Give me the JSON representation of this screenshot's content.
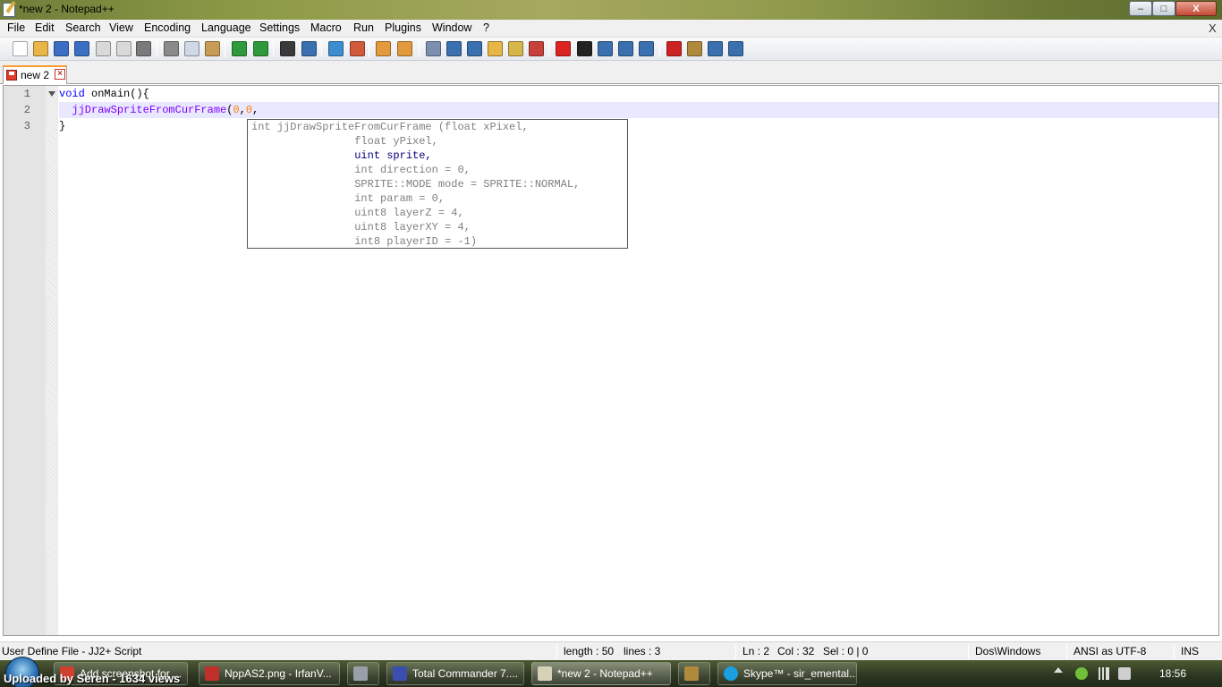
{
  "window": {
    "title": "*new  2 - Notepad++",
    "min_glyph": "–",
    "max_glyph": "□",
    "close_glyph": "X"
  },
  "menu": {
    "items": [
      "File",
      "Edit",
      "Search",
      "View",
      "Encoding",
      "Language",
      "Settings",
      "Macro",
      "Run",
      "Plugins",
      "Window",
      "?"
    ],
    "close_doc": "X"
  },
  "toolbar": {
    "buttons": [
      {
        "name": "new-file-icon",
        "color": "#ffffff"
      },
      {
        "name": "open-file-icon",
        "color": "#e7b646"
      },
      {
        "name": "save-icon",
        "color": "#3b6fc4"
      },
      {
        "name": "save-all-icon",
        "color": "#3b6fc4"
      },
      {
        "name": "close-icon",
        "color": "#d9d9d9"
      },
      {
        "name": "close-all-icon",
        "color": "#d9d9d9"
      },
      {
        "name": "print-icon",
        "color": "#7a7a7a"
      },
      {
        "name": "cut-icon",
        "color": "#8a8a8a"
      },
      {
        "name": "copy-icon",
        "color": "#cfd8e6"
      },
      {
        "name": "paste-icon",
        "color": "#c89b56"
      },
      {
        "name": "undo-icon",
        "color": "#2f9a3b"
      },
      {
        "name": "redo-icon",
        "color": "#2f9a3b"
      },
      {
        "name": "find-icon",
        "color": "#3a3a3a"
      },
      {
        "name": "replace-icon",
        "color": "#3a6fb0"
      },
      {
        "name": "zoom-in-icon",
        "color": "#3b8fd0"
      },
      {
        "name": "zoom-out-icon",
        "color": "#d05a3b"
      },
      {
        "name": "sync-vertical-icon",
        "color": "#e39a3c"
      },
      {
        "name": "sync-horizontal-icon",
        "color": "#e39a3c"
      },
      {
        "name": "word-wrap-icon",
        "color": "#7d8fb0"
      },
      {
        "name": "show-all-chars-icon",
        "color": "#3a6fb0"
      },
      {
        "name": "indent-guide-icon",
        "color": "#3a6fb0"
      },
      {
        "name": "folder-as-workspace-icon",
        "color": "#e7b646"
      },
      {
        "name": "doc-map-icon",
        "color": "#d6b54a"
      },
      {
        "name": "function-list-icon",
        "color": "#c7423b"
      },
      {
        "name": "record-macro-icon",
        "color": "#d22"
      },
      {
        "name": "stop-record-icon",
        "color": "#222"
      },
      {
        "name": "play-macro-icon",
        "color": "#3a6fb0"
      },
      {
        "name": "run-macro-multiple-icon",
        "color": "#3a6fb0"
      },
      {
        "name": "save-macro-icon",
        "color": "#3a6fb0"
      },
      {
        "name": "spell-check-icon",
        "color": "#c22"
      },
      {
        "name": "plugin-a-icon",
        "color": "#b08a3c"
      },
      {
        "name": "plugin-b-icon",
        "color": "#3a6fb0"
      },
      {
        "name": "auto-spell-icon",
        "color": "#3a6fb0"
      }
    ]
  },
  "tabs": [
    {
      "label": "new  2"
    }
  ],
  "editor": {
    "line_numbers": [
      "1",
      "2",
      "3"
    ],
    "line1": {
      "kw": "void",
      "rest": " onMain(){"
    },
    "line2": {
      "indent": "  ",
      "call": "jjDrawSpriteFromCurFrame",
      "open": "(",
      "arg1": "0",
      "comma1": ",",
      "arg2": "0",
      "comma2": ","
    },
    "line3": {
      "text": "}"
    }
  },
  "calltip": {
    "rows": [
      "int jjDrawSpriteFromCurFrame (float xPixel,",
      "                float yPixel,",
      "                uint sprite,",
      "                int direction = 0,",
      "                SPRITE::MODE mode = SPRITE::NORMAL,",
      "                int param = 0,",
      "                uint8 layerZ = 4,",
      "                uint8 layerXY = 4,",
      "                int8 playerID = -1)"
    ],
    "highlighted_row": 2
  },
  "status": {
    "language": "User Define File - JJ2+ Script",
    "length": "length : 50",
    "lines": "lines : 3",
    "ln": "Ln : 2",
    "col": "Col : 32",
    "sel": "Sel : 0 | 0",
    "eol": "Dos\\Windows",
    "encoding": "ANSI as UTF-8",
    "mode": "INS"
  },
  "taskbar": {
    "tasks": [
      {
        "label": "Add screenshot for ...",
        "icon_color": "#d0402f"
      },
      {
        "label": "NppAS2.png - IrfanV...",
        "icon_color": "#c0302a"
      },
      {
        "label": "",
        "icon_color": "#9aa0aa"
      },
      {
        "label": "Total Commander 7....",
        "icon_color": "#3a4fb0"
      },
      {
        "label": "*new  2 - Notepad++",
        "icon_color": "#d6d2b8"
      },
      {
        "label": "",
        "icon_color": "#b08a3c"
      },
      {
        "label": "Skype™ - sir_emental...",
        "icon_color": "#1a9fe0"
      }
    ],
    "clock": "18:56"
  },
  "watermark": "Uploaded by Seren - 1634 views"
}
